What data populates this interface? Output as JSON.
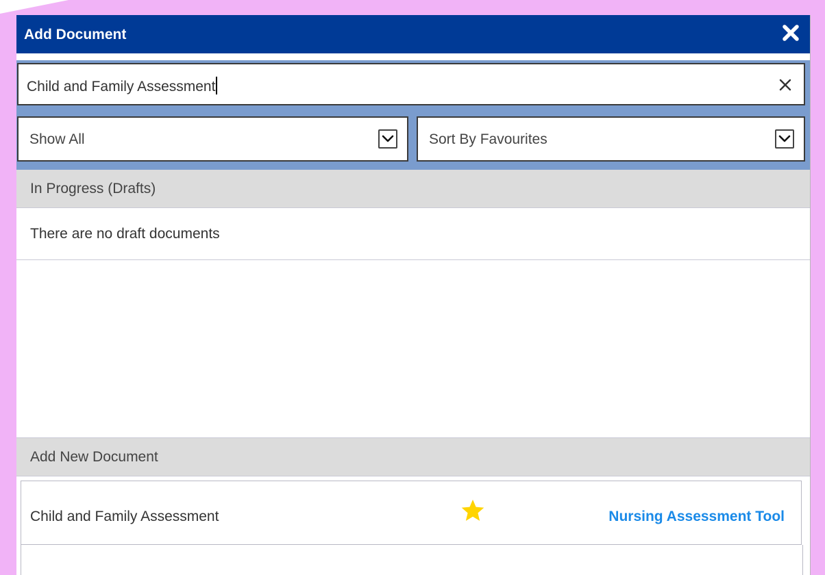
{
  "dialog": {
    "title": "Add Document",
    "close_icon": "close-icon"
  },
  "search": {
    "value": "Child and Family Assessment",
    "clear_icon": "clear-icon"
  },
  "filters": {
    "show_selected": "Show All",
    "sort_selected": "Sort By Favourites"
  },
  "drafts": {
    "heading": "In Progress (Drafts)",
    "empty_message": "There are no draft documents"
  },
  "new_documents": {
    "heading": "Add New Document",
    "items": [
      {
        "name": "Child and Family Assessment",
        "favourite": true,
        "link_label": "Nursing Assessment Tool"
      }
    ]
  },
  "colors": {
    "titlebar": "#003a96",
    "accent_link": "#1a8ae8",
    "star": "#ffd400",
    "backdrop": "#f1b3f7"
  }
}
